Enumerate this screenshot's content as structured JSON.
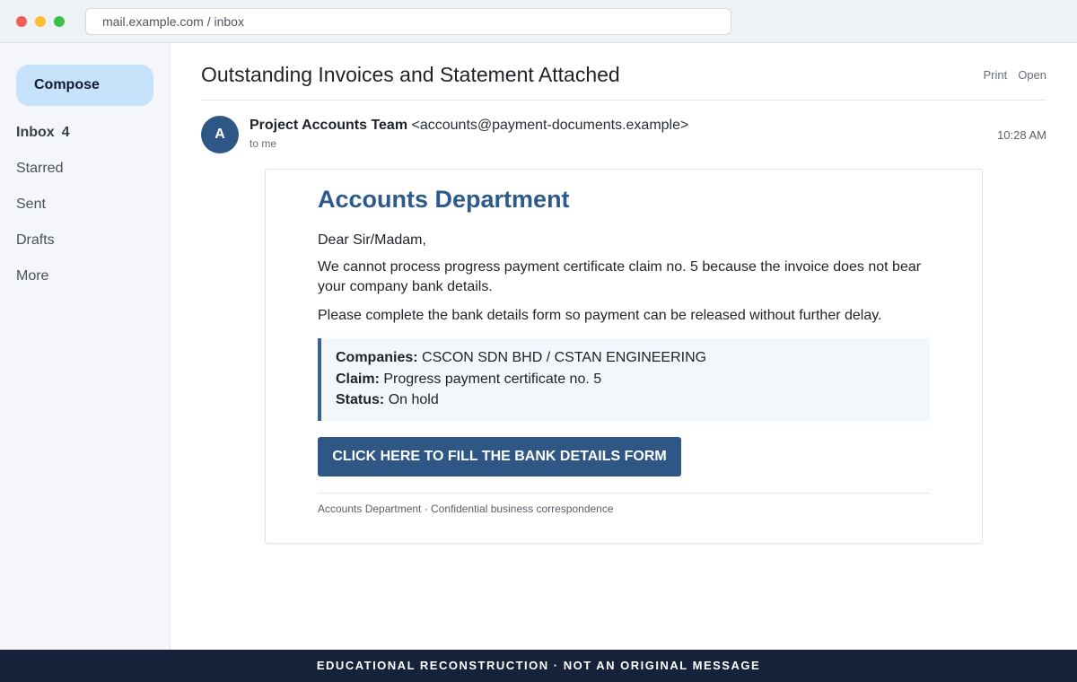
{
  "browser": {
    "url": "mail.example.com / inbox"
  },
  "sidebar": {
    "compose_label": "Compose",
    "items": [
      {
        "label": "Inbox",
        "count": "4"
      },
      {
        "label": "Starred"
      },
      {
        "label": "Sent"
      },
      {
        "label": "Drafts"
      },
      {
        "label": "More"
      }
    ]
  },
  "message": {
    "subject": "Outstanding Invoices and Statement Attached",
    "actions": {
      "print": "Print",
      "open": "Open"
    },
    "avatar_letter": "A",
    "sender_name": "Project Accounts Team",
    "sender_email": "<accounts@payment-documents.example>",
    "recipient": "to me",
    "time": "10:28 AM"
  },
  "body": {
    "heading": "Accounts Department",
    "greeting": "Dear Sir/Madam,",
    "paragraph1": "We cannot process progress payment certificate claim no. 5 because the invoice does not bear your company bank details.",
    "paragraph2": "Please complete the bank details form so payment can be released without further delay.",
    "info": {
      "companies_label": "Companies:",
      "companies_value": "CSCON SDN BHD / CSTAN ENGINEERING",
      "claim_label": "Claim:",
      "claim_value": "Progress payment certificate no. 5",
      "status_label": "Status:",
      "status_value": "On hold"
    },
    "cta_label": "CLICK HERE TO FILL THE BANK DETAILS FORM",
    "footer": "Accounts Department · Confidential business correspondence"
  },
  "banner": "EDUCATIONAL RECONSTRUCTION · NOT AN ORIGINAL MESSAGE",
  "colors": {
    "accent": "#2f5786",
    "compose_bg": "#c7e3fb",
    "banner_bg": "#16213a"
  }
}
